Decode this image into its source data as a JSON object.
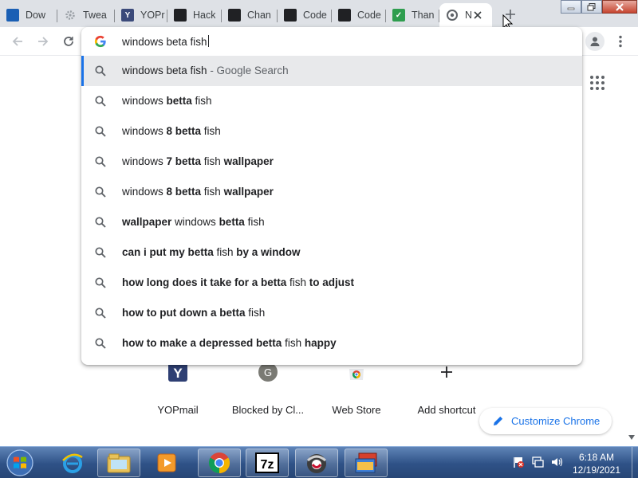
{
  "tabs": [
    {
      "title": "Dow",
      "icon": "download-site-icon",
      "color": "#1a5fb4"
    },
    {
      "title": "Twea",
      "icon": "gear-icon",
      "color": "#9aa0a6"
    },
    {
      "title": "YOPr",
      "icon": "yopmail-icon",
      "color": "#3b4a7a"
    },
    {
      "title": "Hack",
      "icon": "terminal-icon",
      "color": "#202124"
    },
    {
      "title": "Chan",
      "icon": "terminal-icon",
      "color": "#202124"
    },
    {
      "title": "Code",
      "icon": "codepen-icon",
      "color": "#202124"
    },
    {
      "title": "Code",
      "icon": "codepen-icon",
      "color": "#202124"
    },
    {
      "title": "Than",
      "icon": "checkmark-icon",
      "color": "#2e9d4e"
    },
    {
      "title": "N",
      "icon": "chrome-icon",
      "color": "#5f6368",
      "active": true
    }
  ],
  "omnibox": {
    "query": "windows beta fish",
    "suggestions": [
      {
        "parts": [
          {
            "t": "windows beta fish",
            "b": false
          }
        ],
        "suffix": " - Google Search",
        "selected": true
      },
      {
        "parts": [
          {
            "t": "windows ",
            "b": false
          },
          {
            "t": "betta",
            "b": true
          },
          {
            "t": " fish",
            "b": false
          }
        ]
      },
      {
        "parts": [
          {
            "t": "windows ",
            "b": false
          },
          {
            "t": "8 betta",
            "b": true
          },
          {
            "t": " fish",
            "b": false
          }
        ]
      },
      {
        "parts": [
          {
            "t": "windows ",
            "b": false
          },
          {
            "t": "7 betta",
            "b": true
          },
          {
            "t": " fish ",
            "b": false
          },
          {
            "t": "wallpaper",
            "b": true
          }
        ]
      },
      {
        "parts": [
          {
            "t": "windows ",
            "b": false
          },
          {
            "t": "8 betta",
            "b": true
          },
          {
            "t": " fish ",
            "b": false
          },
          {
            "t": "wallpaper",
            "b": true
          }
        ]
      },
      {
        "parts": [
          {
            "t": "wallpaper",
            "b": true
          },
          {
            "t": " windows ",
            "b": false
          },
          {
            "t": "betta",
            "b": true
          },
          {
            "t": " fish",
            "b": false
          }
        ]
      },
      {
        "parts": [
          {
            "t": "can i put my betta",
            "b": true
          },
          {
            "t": " fish ",
            "b": false
          },
          {
            "t": "by a window",
            "b": true
          }
        ]
      },
      {
        "parts": [
          {
            "t": "how long does it take for a betta",
            "b": true
          },
          {
            "t": " fish ",
            "b": false
          },
          {
            "t": "to adjust",
            "b": true
          }
        ]
      },
      {
        "parts": [
          {
            "t": "how to put down a betta",
            "b": true
          },
          {
            "t": " fish",
            "b": false
          }
        ]
      },
      {
        "parts": [
          {
            "t": "how to make a depressed betta",
            "b": true
          },
          {
            "t": " fish ",
            "b": false
          },
          {
            "t": "happy",
            "b": true
          }
        ]
      }
    ]
  },
  "shortcuts": [
    {
      "label": "YOPmail",
      "icon": "yopmail-icon",
      "glyph": "Y"
    },
    {
      "label": "Blocked by Cl...",
      "icon": "generic-site-icon",
      "glyph": "G"
    },
    {
      "label": "Web Store",
      "icon": "chrome-web-store-icon",
      "glyph": ""
    },
    {
      "label": "Add shortcut",
      "icon": "plus-icon",
      "glyph": "+"
    }
  ],
  "customize": {
    "label": "Customize Chrome"
  },
  "taskbar": {
    "apps": [
      "internet-explorer-icon",
      "file-explorer-icon",
      "media-player-icon",
      "chrome-icon",
      "7zip-icon",
      "bandicam-icon",
      "sandbox-icon"
    ],
    "time": "6:18 AM",
    "date": "12/19/2021"
  },
  "colors": {
    "accent": "#1a73e8",
    "tabstrip": "#dee1e6",
    "selected_row": "#e8e9eb"
  }
}
